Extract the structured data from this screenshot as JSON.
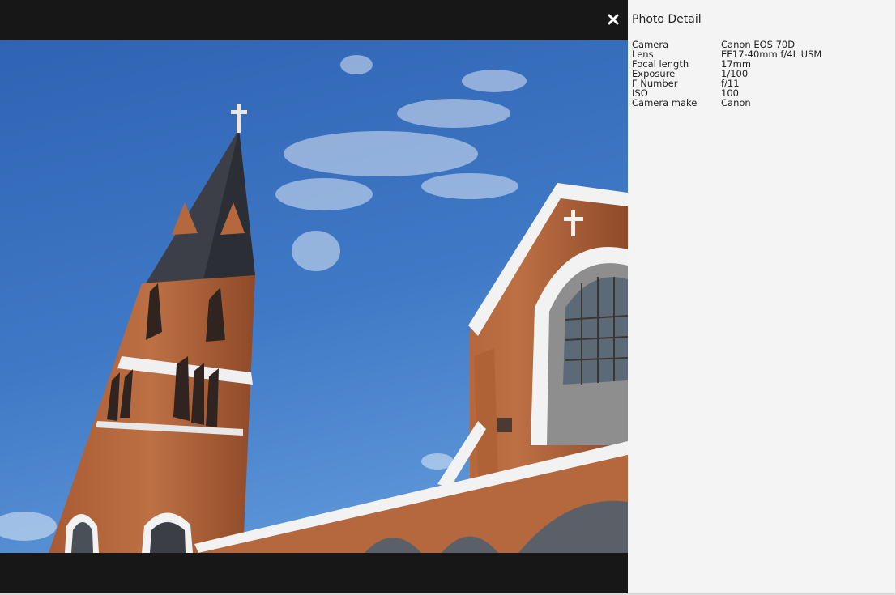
{
  "panel": {
    "title": "Photo Detail",
    "metadata": [
      {
        "label": "Camera",
        "value": "Canon EOS 70D"
      },
      {
        "label": "Lens",
        "value": "EF17-40mm f/4L USM"
      },
      {
        "label": "Focal length",
        "value": "17mm"
      },
      {
        "label": "Exposure",
        "value": "1/100"
      },
      {
        "label": "F Number",
        "value": "f/11"
      },
      {
        "label": "ISO",
        "value": "100"
      },
      {
        "label": "Camera make",
        "value": "Canon"
      }
    ]
  },
  "viewer": {
    "photo_subject": "church-photo",
    "close_icon": "close-icon"
  },
  "colors": {
    "viewer_bg": "#171717",
    "panel_bg": "#f4f4f4",
    "sky": "#3d73c1",
    "brick": "#b5683d",
    "trim": "#f2f2f2"
  }
}
